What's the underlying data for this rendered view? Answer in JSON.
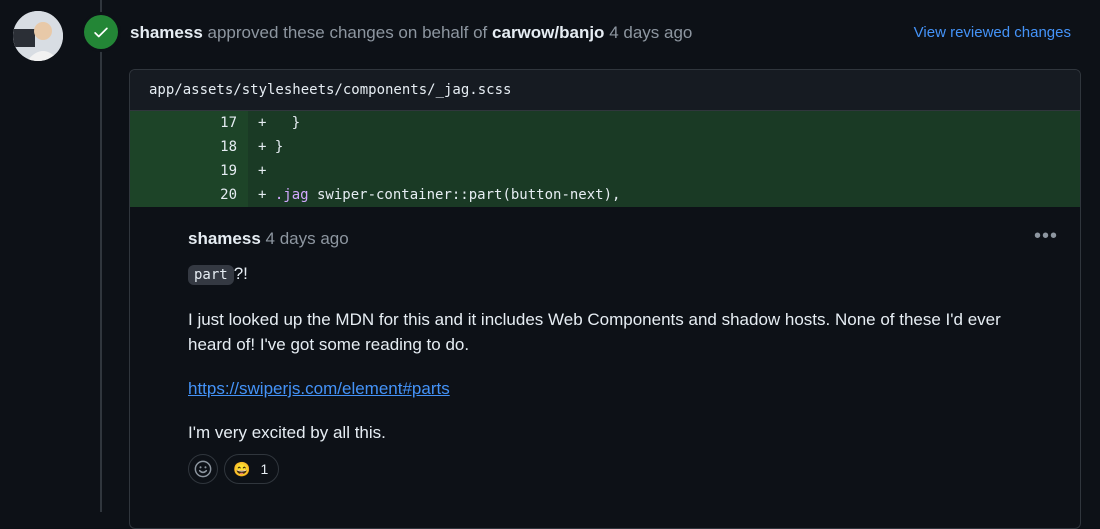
{
  "review": {
    "user": "shamess",
    "action": "approved these changes on behalf of",
    "repo": "carwow/banjo",
    "time": "4 days ago",
    "view_changes_label": "View reviewed changes",
    "status_color": "#238636"
  },
  "file": {
    "path": "app/assets/stylesheets/components/_jag.scss",
    "lines": [
      {
        "num": "17",
        "code": "+   }"
      },
      {
        "num": "18",
        "code": "+ }"
      },
      {
        "num": "19",
        "code": "+"
      },
      {
        "num": "20",
        "prefix": "+ ",
        "selector": ".jag",
        "rest": " swiper-container::part(button-next),"
      }
    ]
  },
  "comment": {
    "user": "shamess",
    "time": "4 days ago",
    "more_icon": "kebab-horizontal-icon",
    "inline_code": "part",
    "inline_code_suffix": "?!",
    "paragraph1": "I just looked up the MDN for this and it includes Web Components and shadow hosts. None of these I'd ever heard of! I've got some reading to do.",
    "link": "https://swiperjs.com/element#parts",
    "paragraph3": "I'm very excited by all this.",
    "reactions": [
      {
        "emoji": "😄",
        "count": "1"
      }
    ]
  }
}
